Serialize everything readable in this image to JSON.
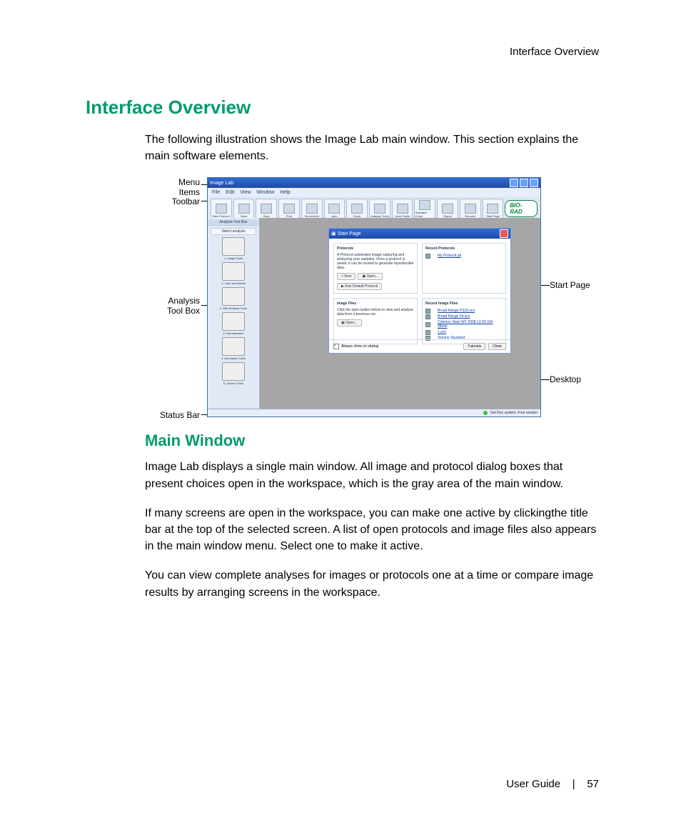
{
  "runningHead": "Interface Overview",
  "h1": "Interface Overview",
  "intro": "The following illustration shows the Image Lab main window. This section explains the main software elements.",
  "h2": "Main Window",
  "p1": "Image Lab displays a single main window. All image and protocol dialog boxes that present choices open in the workspace, which is the gray area of the main window.",
  "p2": "If many screens are open in the workspace, you can make one active by clickingthe title bar at the top of the selected screen. A list of open protocols and image files also appears in the main window menu. Select one to make it active.",
  "p3": "You can view complete analyses for images or protocols one at a time or compare image results by arranging screens in the workspace.",
  "footer": {
    "left": "User Guide",
    "sep": "|",
    "page": "57"
  },
  "callouts": {
    "menuItems": "Menu\nItems",
    "toolbar": "Toolbar",
    "analysis": "Analysis\nTool Box",
    "statusBar": "Status Bar",
    "startPage": "Start Page",
    "desktop": "Desktop"
  },
  "app": {
    "title": "Image Lab",
    "menu": [
      "File",
      "Edit",
      "View",
      "Window",
      "Help"
    ],
    "toolbar": [
      "New Protocol",
      "Open",
      "Save",
      "Print",
      "Screenshot",
      "Auto",
      "Zoom",
      "Analysis Tools",
      "Lane Profile",
      "Standard Curve",
      "Report",
      "Rename",
      "Start Page"
    ],
    "logo": "BIO-RAD",
    "analysisHeader": "Analysis Tool Box",
    "analysisSearch": "Select analysis",
    "tools": [
      "1. Image Tools",
      "2. Lane and Bands",
      "3. MW Analysis Tools",
      "4. Normalization",
      "5. Annotation Tools",
      "6. Volume Tools"
    ],
    "status": "Gel Doc system: Free version"
  },
  "dlg": {
    "title": "Start Page",
    "protocols": {
      "head": "Protocols",
      "desc": "A Protocol automates image capturing and analyzing your samples. Once a protocol is saved, it can be reused to generate reproducible data.",
      "new": "New",
      "open": "Open...",
      "run": "Run Default Protocol"
    },
    "recentProtocols": {
      "head": "Recent Protocols",
      "items": [
        "My Protocol.ptl"
      ]
    },
    "imageFiles": {
      "head": "Image Files",
      "desc": "Click the open button below to view and analyze data from a previous run.",
      "open": "Open..."
    },
    "recentImages": {
      "head": "Recent Image Files",
      "items": [
        "Broad Range PS10.scn",
        "Broad Range 54.scn",
        "Criterion Stain WV 2008-12-09 10h 38min",
        "1.scn",
        "Volume Standard"
      ]
    },
    "always": "Always show on startup",
    "tutorials": "Tutorials",
    "close": "Close"
  }
}
